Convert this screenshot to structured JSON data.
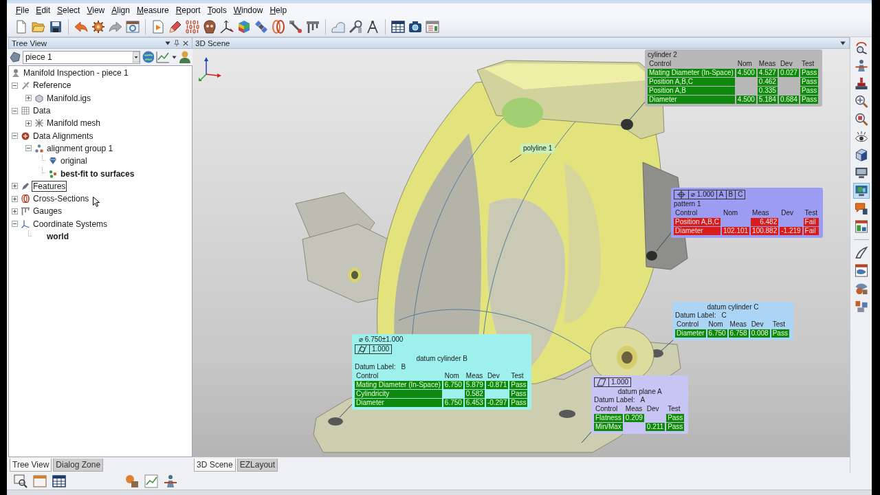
{
  "menu": [
    "File",
    "Edit",
    "Select",
    "View",
    "Align",
    "Measure",
    "Report",
    "Tools",
    "Window",
    "Help"
  ],
  "tree_panel": {
    "title": "Tree View",
    "piece": "piece 1",
    "root": {
      "label": "Manifold Inspection - piece 1",
      "kind": "part"
    },
    "items": [
      {
        "label": "Reference",
        "kind": "reference",
        "expanded": true,
        "active": false,
        "focused": false,
        "children": [
          {
            "label": "Manifold.igs",
            "kind": "cad",
            "expanded": false,
            "active": false,
            "focused": false
          }
        ]
      },
      {
        "label": "Data",
        "kind": "data",
        "expanded": true,
        "active": false,
        "focused": false,
        "children": [
          {
            "label": "Manifold mesh",
            "kind": "mesh",
            "expanded": false,
            "active": false,
            "focused": false
          }
        ]
      },
      {
        "label": "Data Alignments",
        "kind": "alignments",
        "expanded": true,
        "active": false,
        "focused": false,
        "children": [
          {
            "label": "alignment group 1",
            "kind": "group",
            "expanded": true,
            "active": false,
            "focused": false,
            "children": [
              {
                "label": "original",
                "kind": "original",
                "active": false,
                "focused": false
              },
              {
                "label": "best-fit to surfaces",
                "kind": "bestfit",
                "active": true,
                "focused": false
              }
            ]
          }
        ]
      },
      {
        "label": "Features",
        "kind": "features",
        "expanded": false,
        "active": false,
        "focused": true
      },
      {
        "label": "Cross-Sections",
        "kind": "sections",
        "expanded": false,
        "active": false,
        "focused": false
      },
      {
        "label": "Gauges",
        "kind": "gauges",
        "expanded": false,
        "active": false,
        "focused": false
      },
      {
        "label": "Coordinate Systems",
        "kind": "coordinates",
        "expanded": true,
        "active": false,
        "focused": false,
        "children": [
          {
            "label": "world",
            "kind": "system",
            "active": true,
            "focused": false
          }
        ]
      }
    ],
    "tabs": [
      {
        "label": "Tree View",
        "selected": true
      },
      {
        "label": "Dialog Zone",
        "selected": false
      }
    ]
  },
  "scene": {
    "title": "3D Scene",
    "labels": [
      {
        "text": "polyline 1"
      }
    ],
    "callouts": [
      {
        "title": "cylinder 2",
        "color": "#b8b8b8",
        "columns": [
          "Control",
          "Nom",
          "Meas",
          "Dev",
          "Test"
        ],
        "rows": [
          {
            "cells": [
              "Mating Diameter (In-Space)",
              "4.500",
              "4.527",
              "0.027",
              "Pass"
            ],
            "passed": true
          },
          {
            "cells": [
              "Position A,B,C",
              null,
              "0.462",
              null,
              "Pass"
            ],
            "passed": true
          },
          {
            "cells": [
              "Position A,B",
              null,
              "0.335",
              null,
              "Pass"
            ],
            "passed": true
          },
          {
            "cells": [
              "Diameter",
              "4.500",
              "5.184",
              "0.684",
              "Pass"
            ],
            "passed": true
          }
        ]
      },
      {
        "title": "pattern 1",
        "color": "#9c9cf2",
        "frame": [
          {
            "kind": "position"
          },
          {
            "kind": "value",
            "text": "⌀ 1.000"
          },
          {
            "kind": "datum",
            "text": "A"
          },
          {
            "kind": "datum",
            "text": "B"
          },
          {
            "kind": "datum",
            "text": "C"
          }
        ],
        "columns": [
          "Control",
          "Nom",
          "Meas",
          "Dev",
          "Test"
        ],
        "rows": [
          {
            "cells": [
              "Position A,B,C",
              null,
              "6.482",
              null,
              "Fail"
            ],
            "passed": false
          },
          {
            "cells": [
              "Diameter",
              "102.101",
              "100.882",
              "-1.219",
              "Fail"
            ],
            "passed": false
          }
        ]
      },
      {
        "title": "datum cylinder C",
        "color": "#acd4f4",
        "datum_label": {
          "caption": "Datum Label:",
          "value": "C"
        },
        "columns": [
          "Control",
          "Nom",
          "Meas",
          "Dev",
          "Test"
        ],
        "rows": [
          {
            "cells": [
              "Diameter",
              "6.750",
              "6.758",
              "0.008",
              "Pass"
            ],
            "passed": true
          }
        ]
      },
      {
        "title": "datum cylinder B",
        "color": "#9ef0ec",
        "size": "⌀ 6.750±1.000",
        "frame": [
          {
            "kind": "cylindricity"
          },
          {
            "kind": "value",
            "text": "1.000"
          }
        ],
        "datum_label": {
          "caption": "Datum Label:",
          "value": "B"
        },
        "columns": [
          "Control",
          "Nom",
          "Meas",
          "Dev",
          "Test"
        ],
        "rows": [
          {
            "cells": [
              "Mating Diameter (In-Space)",
              "6.750",
              "5.879",
              "-0.871",
              "Pass"
            ],
            "passed": true
          },
          {
            "cells": [
              "Cylindricity",
              null,
              "0.582",
              null,
              "Pass"
            ],
            "passed": true
          },
          {
            "cells": [
              "Diameter",
              "6.750",
              "6.453",
              "-0.297",
              "Pass"
            ],
            "passed": true
          }
        ]
      },
      {
        "title": "datum plane A",
        "color": "#c8c4f4",
        "frame": [
          {
            "kind": "flatness"
          },
          {
            "kind": "value",
            "text": "1.000"
          }
        ],
        "datum_label": {
          "caption": "Datum Label:",
          "value": "A"
        },
        "columns": [
          "Control",
          "Meas",
          "Dev",
          "Test"
        ],
        "rows": [
          {
            "cells": [
              "Flatness",
              "0.209",
              null,
              "Pass"
            ],
            "passed": true
          },
          {
            "cells": [
              "Min/Max",
              null,
              "0.211",
              "Pass"
            ],
            "passed": true
          }
        ]
      }
    ],
    "tabs": [
      {
        "label": "3D Scene",
        "selected": true
      },
      {
        "label": "EZLayout",
        "selected": false
      }
    ]
  },
  "right_toolbar": [
    {
      "on": false
    },
    {
      "on": false
    },
    {
      "on": false
    },
    {
      "on": false
    },
    {
      "on": false
    },
    {
      "on": false
    },
    {
      "on": false
    },
    {
      "on": false
    },
    {
      "on": true
    },
    {
      "on": false
    },
    {
      "on": false
    },
    {
      "on": false
    },
    {
      "on": false
    },
    {
      "on": false
    },
    {
      "on": false
    }
  ]
}
